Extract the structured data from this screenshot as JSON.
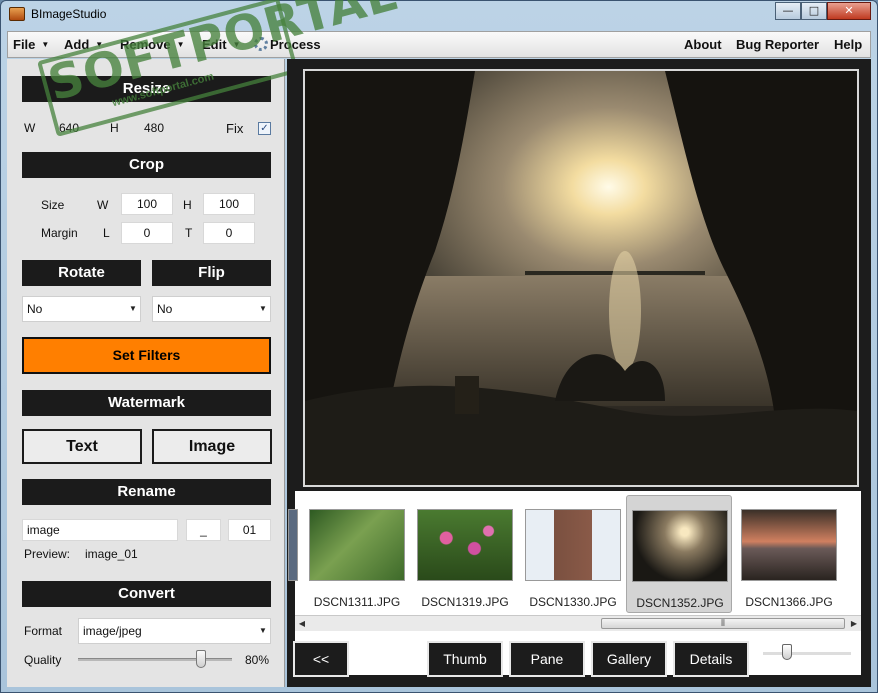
{
  "window": {
    "title": "BImageStudio",
    "buttons": {
      "minimize": "—",
      "maximize": "□",
      "close": "✕"
    }
  },
  "menu": {
    "file": "File",
    "add": "Add",
    "remove": "Remove",
    "edit": "Edit",
    "process": "Process",
    "about": "About",
    "bug_reporter": "Bug Reporter",
    "help": "Help"
  },
  "resize": {
    "header": "Resize",
    "w_label": "W",
    "w_value": "640",
    "h_label": "H",
    "h_value": "480",
    "fix_label": "Fix",
    "fix_checked": true
  },
  "crop": {
    "header": "Crop",
    "size_label": "Size",
    "w_label": "W",
    "w_value": "100",
    "h_label": "H",
    "h_value": "100",
    "margin_label": "Margin",
    "l_label": "L",
    "l_value": "0",
    "t_label": "T",
    "t_value": "0"
  },
  "rotate": {
    "header": "Rotate",
    "value": "No"
  },
  "flip": {
    "header": "Flip",
    "value": "No"
  },
  "set_filters": "Set Filters",
  "watermark": {
    "header": "Watermark",
    "text_button": "Text",
    "image_button": "Image"
  },
  "rename": {
    "header": "Rename",
    "name_value": "image",
    "separator_value": "_",
    "start_value": "01",
    "preview_label": "Preview:",
    "preview_value": "image_01"
  },
  "convert": {
    "header": "Convert",
    "format_label": "Format",
    "format_value": "image/jpeg",
    "quality_label": "Quality",
    "quality_value": "80%",
    "quality": 0.8
  },
  "stamp": {
    "main": "SOFTPORTAL",
    "url": "www.softportal.com"
  },
  "gallery": {
    "thumbnails": [
      {
        "name": "DSCN1311.JPG",
        "selected": false
      },
      {
        "name": "DSCN1319.JPG",
        "selected": false
      },
      {
        "name": "DSCN1330.JPG",
        "selected": false
      },
      {
        "name": "DSCN1352.JPG",
        "selected": true
      },
      {
        "name": "DSCN1366.JPG",
        "selected": false
      }
    ]
  },
  "view_buttons": {
    "back": "<<",
    "thumb": "Thumb",
    "pane": "Pane",
    "gallery": "Gallery",
    "details": "Details"
  },
  "colors": {
    "accent": "#ff7f00",
    "header_bg": "#1b1b1b",
    "stamp": "#46823c"
  }
}
